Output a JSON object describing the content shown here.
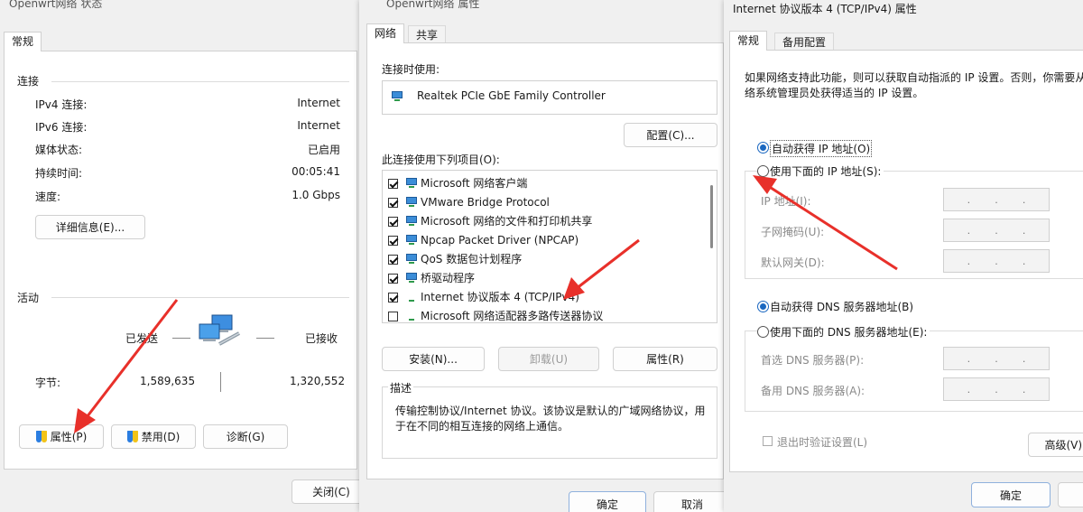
{
  "status_dialog": {
    "title": "Openwrt网络 状态",
    "tab_general": "常规",
    "section_connection": "连接",
    "rows": [
      {
        "label": "IPv4 连接:",
        "value": "Internet"
      },
      {
        "label": "IPv6 连接:",
        "value": "Internet"
      },
      {
        "label": "媒体状态:",
        "value": "已启用"
      },
      {
        "label": "持续时间:",
        "value": "00:05:41"
      },
      {
        "label": "速度:",
        "value": "1.0 Gbps"
      }
    ],
    "details_button": "详细信息(E)...",
    "section_activity": "活动",
    "sent_label": "已发送",
    "received_label": "已接收",
    "bytes_label": "字节:",
    "bytes_sent": "1,589,635",
    "bytes_received": "1,320,552",
    "properties_button": "属性(P)",
    "disable_button": "禁用(D)",
    "diagnose_button": "诊断(G)",
    "close_button": "关闭(C)"
  },
  "properties_dialog": {
    "title": "Openwrt网络 属性",
    "tab_network": "网络",
    "tab_sharing": "共享",
    "connect_using_label": "连接时使用:",
    "adapter_name": "Realtek PCIe GbE Family Controller",
    "configure_button": "配置(C)...",
    "items_label": "此连接使用下列项目(O):",
    "items": [
      {
        "label": "Microsoft 网络客户端",
        "checked": true
      },
      {
        "label": "VMware Bridge Protocol",
        "checked": true
      },
      {
        "label": "Microsoft 网络的文件和打印机共享",
        "checked": true
      },
      {
        "label": "Npcap Packet Driver (NPCAP)",
        "checked": true
      },
      {
        "label": "QoS 数据包计划程序",
        "checked": true
      },
      {
        "label": "桥驱动程序",
        "checked": true
      },
      {
        "label": "Internet 协议版本 4 (TCP/IPv4)",
        "checked": true
      },
      {
        "label": "Microsoft 网络适配器多路传送器协议",
        "checked": false
      }
    ],
    "install_button": "安装(N)...",
    "uninstall_button": "卸载(U)",
    "properties_button": "属性(R)",
    "description_label": "描述",
    "description_text_1": "传输控制协议/Internet 协议。该协议是默认的广域网络协议，用",
    "description_text_2": "于在不同的相互连接的网络上通信。",
    "ok_button": "确定",
    "cancel_button": "取消"
  },
  "ipv4_dialog": {
    "title": "Internet 协议版本 4 (TCP/IPv4) 属性",
    "tab_general": "常规",
    "tab_alternate": "备用配置",
    "intro_1": "如果网络支持此功能，则可以获取自动指派的 IP 设置。否则，你需要从",
    "intro_2": "络系统管理员处获得适当的 IP 设置。",
    "auto_ip": "自动获得 IP 地址(O)",
    "manual_ip": "使用下面的 IP 地址(S):",
    "ip_address": "IP 地址(I):",
    "subnet_mask": "子网掩码(U):",
    "default_gateway": "默认网关(D):",
    "auto_dns": "自动获得 DNS 服务器地址(B)",
    "manual_dns": "使用下面的 DNS 服务器地址(E):",
    "preferred_dns": "首选 DNS 服务器(P):",
    "alternate_dns": "备用 DNS 服务器(A):",
    "validate_on_exit": "退出时验证设置(L)",
    "advanced_button": "高级(V)...",
    "ok_button": "确定",
    "ip_dot": "."
  },
  "colors": {
    "annotation_arrow": "#e8302a",
    "radio_selected": "#1a67c0"
  }
}
